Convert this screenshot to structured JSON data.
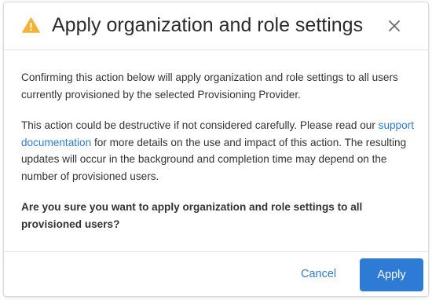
{
  "dialog": {
    "title": "Apply organization and role settings",
    "icons": {
      "warning": "warning-icon",
      "close": "close-icon"
    },
    "paragraph1": "Confirming this action below will apply organization and role settings to all users currently provisioned by the selected Provisioning Provider.",
    "paragraph2": {
      "before_link": "This action could be destructive if not considered carefully. Please read our ",
      "link_text": "support documentation",
      "after_link": " for more details on the use and impact of this action. The resulting updates will occur in the background and completion time may depend on the number of provisioned users."
    },
    "question": "Are you sure you want to apply organization and role settings to all provisioned users?",
    "cancel_label": "Cancel",
    "apply_label": "Apply"
  },
  "colors": {
    "warning": "#f2b233",
    "link": "#2f7bcb",
    "primary": "#2e7bd6"
  }
}
